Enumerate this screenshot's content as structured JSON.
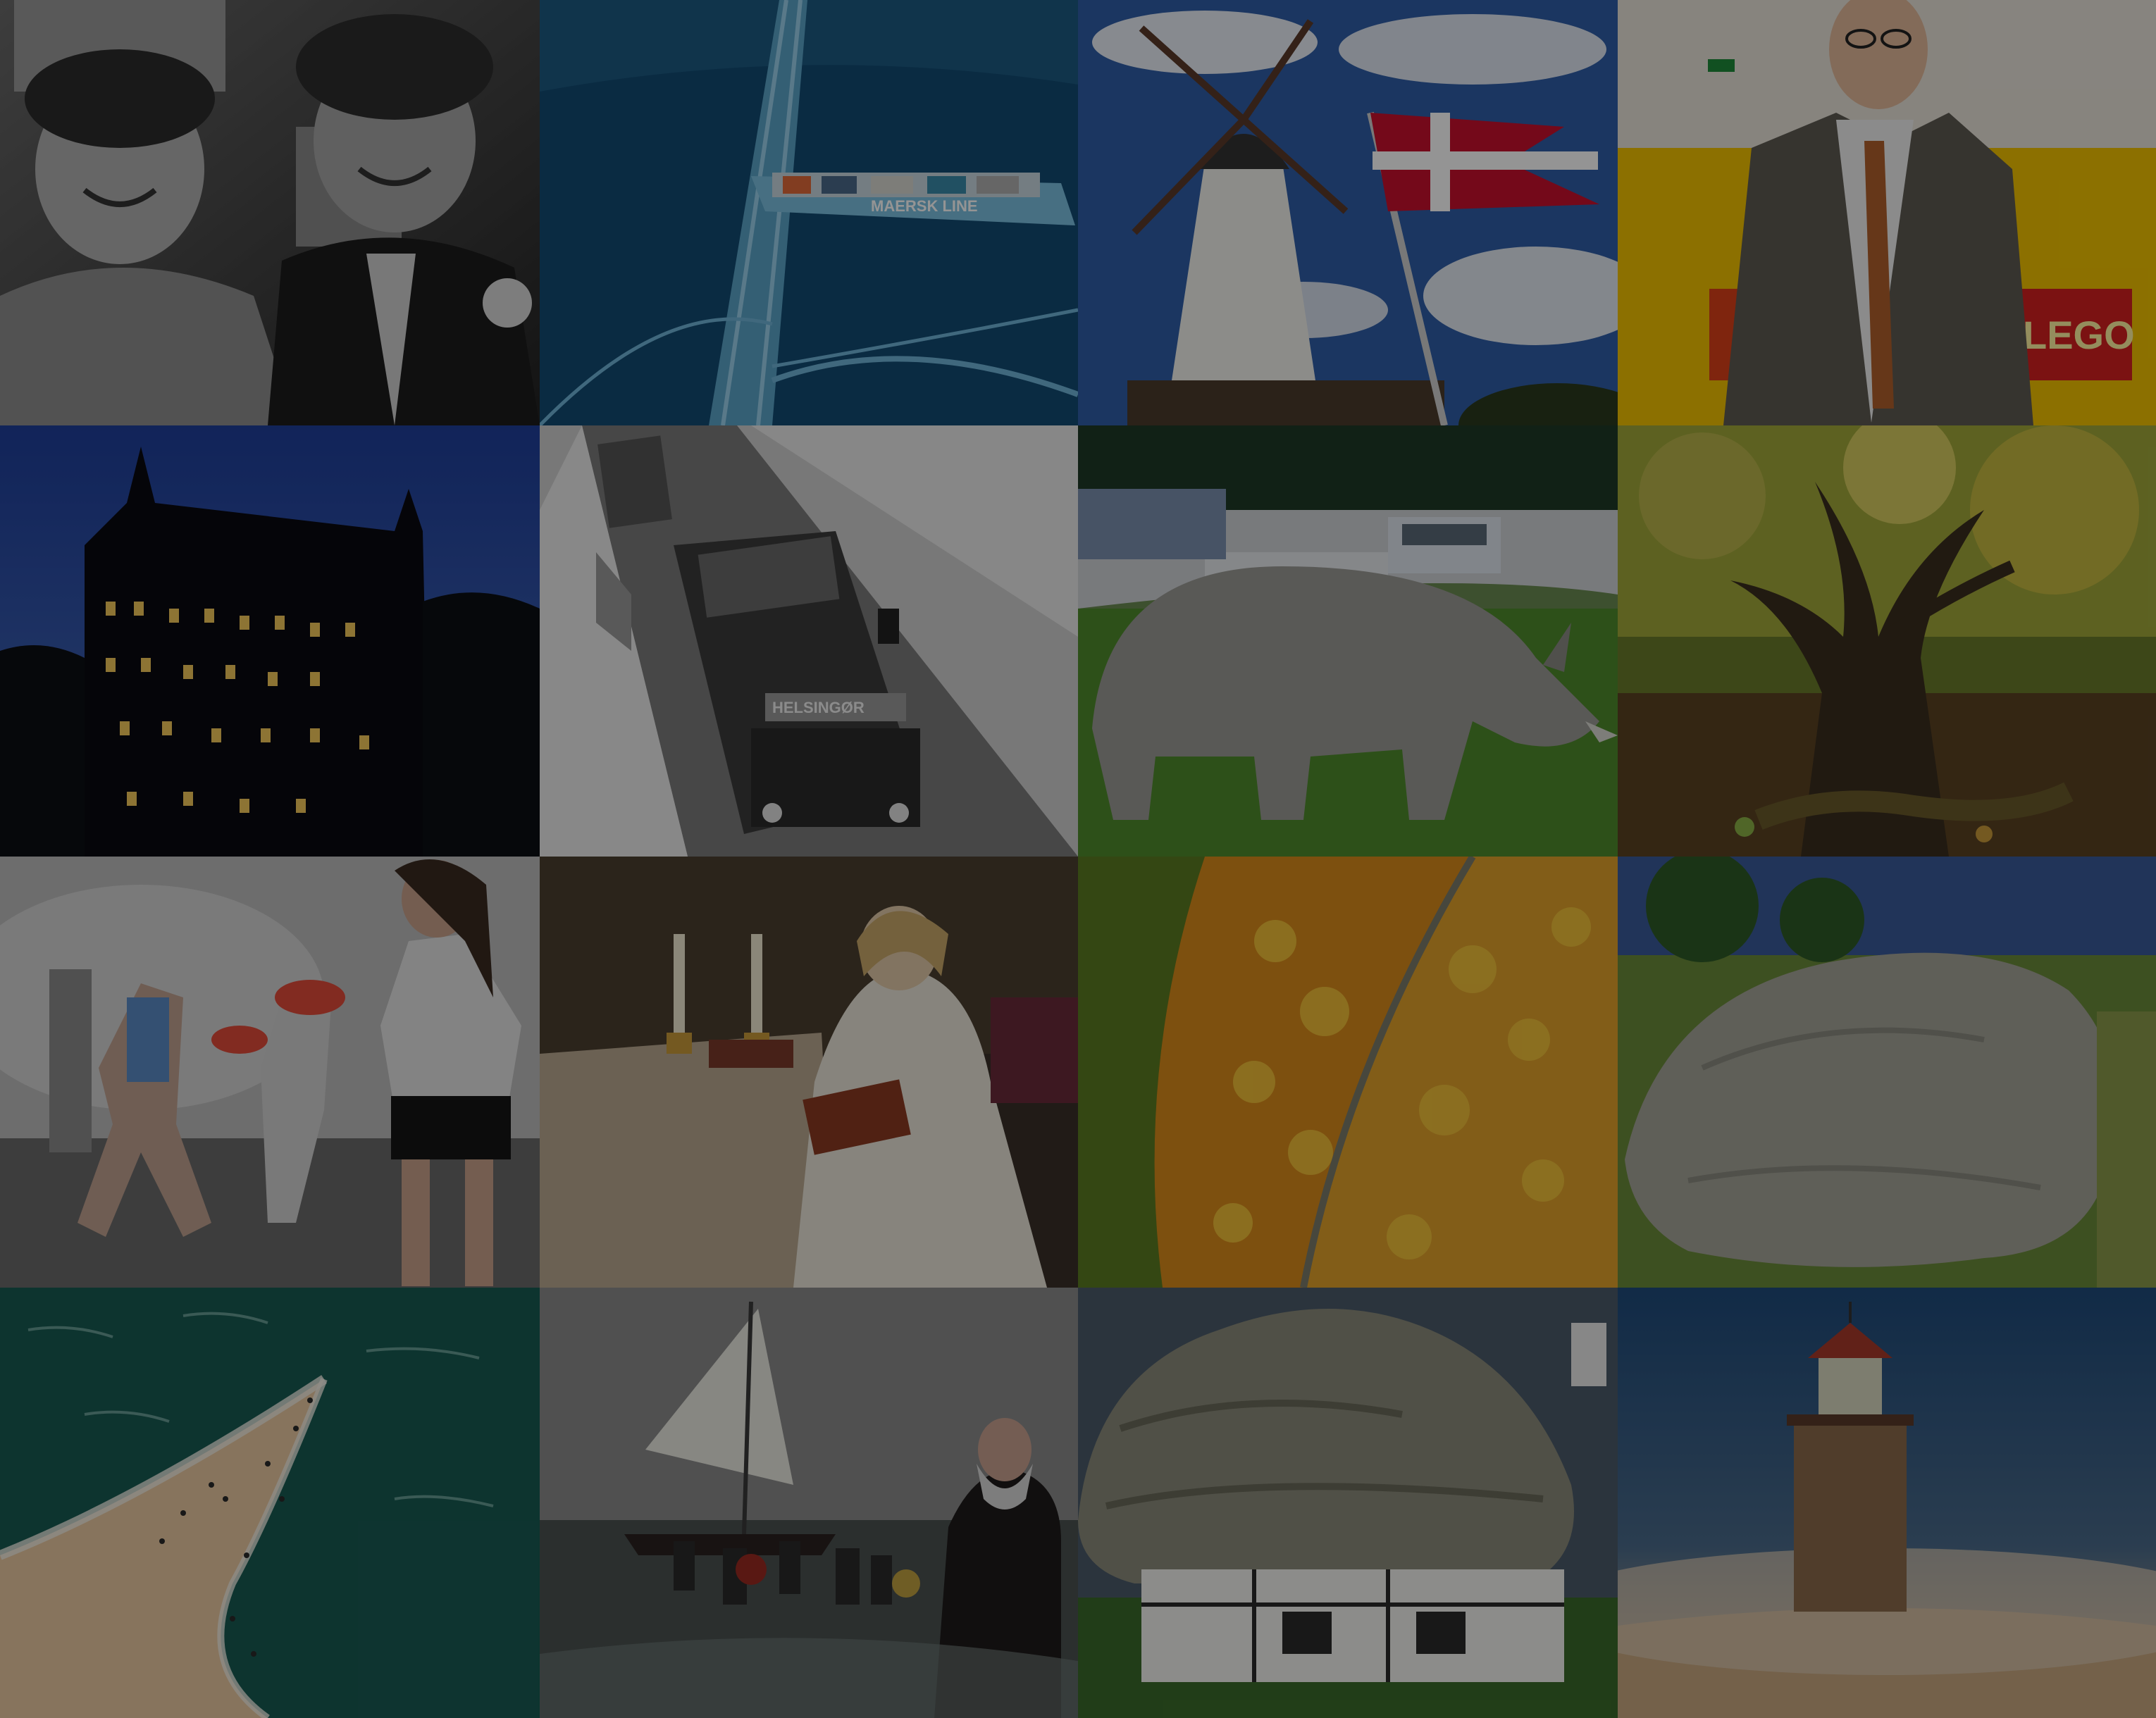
{
  "title": "",
  "tiles": [
    {
      "row": 1,
      "col": 1,
      "subject": "black-and-white portrait of two smiling men"
    },
    {
      "row": 1,
      "col": 2,
      "subject": "aerial view from bridge pylon over container ship"
    },
    {
      "row": 1,
      "col": 3,
      "subject": "white windmill with red-and-white swallow-tailed flag"
    },
    {
      "row": 1,
      "col": 4,
      "subject": "man in suit in front of yellow LEGO backdrop"
    },
    {
      "row": 2,
      "col": 1,
      "subject": "castle at dusk reflected in moat"
    },
    {
      "row": 2,
      "col": 2,
      "subject": "black-and-white vintage buses on snowy road"
    },
    {
      "row": 2,
      "col": 3,
      "subject": "rhinoceros grazing near parked cars"
    },
    {
      "row": 2,
      "col": 4,
      "subject": "gnarled oak tree in autumn forest"
    },
    {
      "row": 3,
      "col": 1,
      "subject": "runners splashed with water"
    },
    {
      "row": 3,
      "col": 2,
      "subject": "painting of woman reading by candlelight"
    },
    {
      "row": 3,
      "col": 3,
      "subject": "aerial view of autumn forest and road"
    },
    {
      "row": 3,
      "col": 4,
      "subject": "large boulder in grassy field"
    },
    {
      "row": 4,
      "col": 1,
      "subject": "aerial view of sand spit with people"
    },
    {
      "row": 4,
      "col": 2,
      "subject": "vikings wading ashore from sail ship"
    },
    {
      "row": 4,
      "col": 3,
      "subject": "house built beneath a giant rock"
    },
    {
      "row": 4,
      "col": 4,
      "subject": "lighthouse in drifting sand mist"
    }
  ],
  "photo_texts": {
    "bus_destination": "HELSINGØR",
    "ship_hull": "MAERSK LINE",
    "lego_logo": "LEGO"
  },
  "colors": {
    "lego_yellow": "#f2c200",
    "lego_red": "#d51f1f",
    "flag_red": "#c8102e",
    "autumn_orange": "#e09a1c"
  }
}
